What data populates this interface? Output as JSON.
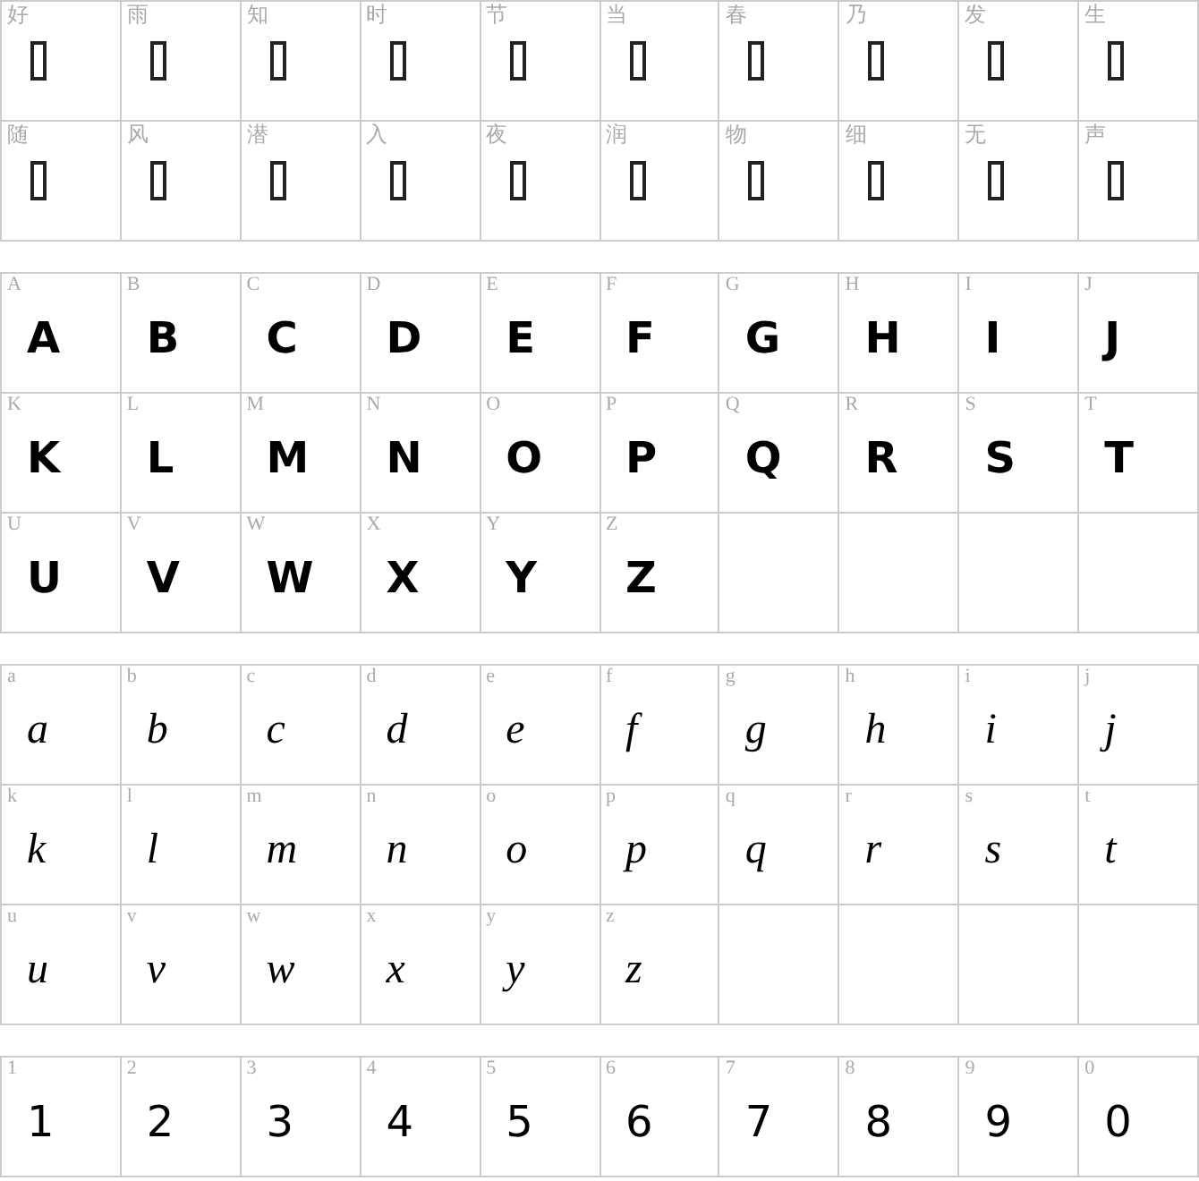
{
  "sections": [
    {
      "kind": "cjk",
      "cells": [
        {
          "label": "好"
        },
        {
          "label": "雨"
        },
        {
          "label": "知"
        },
        {
          "label": "时"
        },
        {
          "label": "节"
        },
        {
          "label": "当"
        },
        {
          "label": "春"
        },
        {
          "label": "乃"
        },
        {
          "label": "发"
        },
        {
          "label": "生"
        },
        {
          "label": "随"
        },
        {
          "label": "风"
        },
        {
          "label": "潜"
        },
        {
          "label": "入"
        },
        {
          "label": "夜"
        },
        {
          "label": "润"
        },
        {
          "label": "物"
        },
        {
          "label": "细"
        },
        {
          "label": "无"
        },
        {
          "label": "声"
        }
      ]
    },
    {
      "kind": "upper",
      "cells": [
        {
          "label": "A",
          "glyph": "A"
        },
        {
          "label": "B",
          "glyph": "B"
        },
        {
          "label": "C",
          "glyph": "C"
        },
        {
          "label": "D",
          "glyph": "D"
        },
        {
          "label": "E",
          "glyph": "E"
        },
        {
          "label": "F",
          "glyph": "F"
        },
        {
          "label": "G",
          "glyph": "G"
        },
        {
          "label": "H",
          "glyph": "H"
        },
        {
          "label": "I",
          "glyph": "I"
        },
        {
          "label": "J",
          "glyph": "J"
        },
        {
          "label": "K",
          "glyph": "K"
        },
        {
          "label": "L",
          "glyph": "L"
        },
        {
          "label": "M",
          "glyph": "M"
        },
        {
          "label": "N",
          "glyph": "N"
        },
        {
          "label": "O",
          "glyph": "O"
        },
        {
          "label": "P",
          "glyph": "P"
        },
        {
          "label": "Q",
          "glyph": "Q"
        },
        {
          "label": "R",
          "glyph": "R"
        },
        {
          "label": "S",
          "glyph": "S"
        },
        {
          "label": "T",
          "glyph": "T"
        },
        {
          "label": "U",
          "glyph": "U"
        },
        {
          "label": "V",
          "glyph": "V"
        },
        {
          "label": "W",
          "glyph": "W"
        },
        {
          "label": "X",
          "glyph": "X"
        },
        {
          "label": "Y",
          "glyph": "Y"
        },
        {
          "label": "Z",
          "glyph": "Z"
        }
      ]
    },
    {
      "kind": "lower",
      "cells": [
        {
          "label": "a",
          "glyph": "a"
        },
        {
          "label": "b",
          "glyph": "b"
        },
        {
          "label": "c",
          "glyph": "c"
        },
        {
          "label": "d",
          "glyph": "d"
        },
        {
          "label": "e",
          "glyph": "e"
        },
        {
          "label": "f",
          "glyph": "f"
        },
        {
          "label": "g",
          "glyph": "g"
        },
        {
          "label": "h",
          "glyph": "h"
        },
        {
          "label": "i",
          "glyph": "i"
        },
        {
          "label": "j",
          "glyph": "j"
        },
        {
          "label": "k",
          "glyph": "k"
        },
        {
          "label": "l",
          "glyph": "l"
        },
        {
          "label": "m",
          "glyph": "m"
        },
        {
          "label": "n",
          "glyph": "n"
        },
        {
          "label": "o",
          "glyph": "o"
        },
        {
          "label": "p",
          "glyph": "p"
        },
        {
          "label": "q",
          "glyph": "q"
        },
        {
          "label": "r",
          "glyph": "r"
        },
        {
          "label": "s",
          "glyph": "s"
        },
        {
          "label": "t",
          "glyph": "t"
        },
        {
          "label": "u",
          "glyph": "u"
        },
        {
          "label": "v",
          "glyph": "v"
        },
        {
          "label": "w",
          "glyph": "w"
        },
        {
          "label": "x",
          "glyph": "x"
        },
        {
          "label": "y",
          "glyph": "y"
        },
        {
          "label": "z",
          "glyph": "z"
        }
      ]
    },
    {
      "kind": "digit",
      "cells": [
        {
          "label": "1",
          "glyph": "1"
        },
        {
          "label": "2",
          "glyph": "2"
        },
        {
          "label": "3",
          "glyph": "3"
        },
        {
          "label": "4",
          "glyph": "4"
        },
        {
          "label": "5",
          "glyph": "5"
        },
        {
          "label": "6",
          "glyph": "6"
        },
        {
          "label": "7",
          "glyph": "7"
        },
        {
          "label": "8",
          "glyph": "8"
        },
        {
          "label": "9",
          "glyph": "9"
        },
        {
          "label": "0",
          "glyph": "0"
        }
      ]
    }
  ]
}
